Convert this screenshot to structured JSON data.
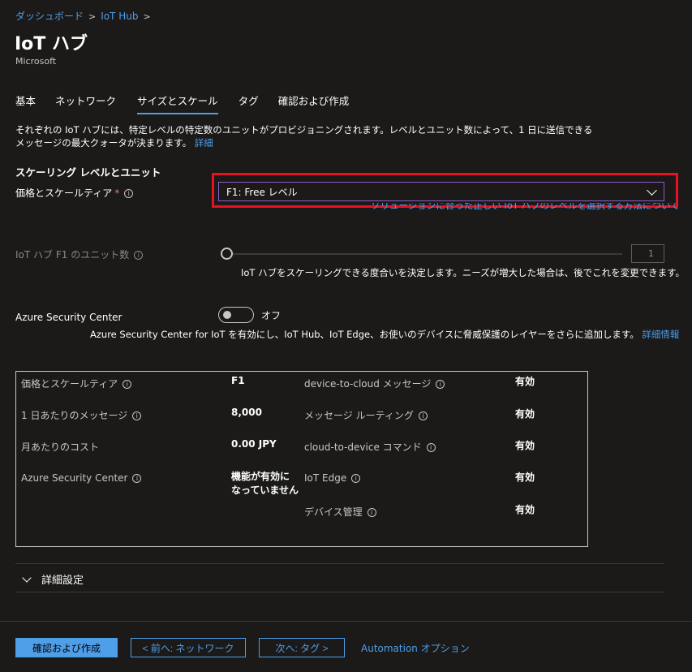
{
  "breadcrumb": {
    "items": [
      "ダッシュボード",
      "IoT Hub"
    ]
  },
  "header": {
    "title": "IoT ハブ",
    "subtitle": "Microsoft"
  },
  "tabs": [
    {
      "label": "基本"
    },
    {
      "label": "ネットワーク"
    },
    {
      "label": "サイズとスケール"
    },
    {
      "label": "タグ"
    },
    {
      "label": "確認および作成"
    }
  ],
  "intro": {
    "text": "それぞれの IoT ハブには、特定レベルの特定数のユニットがプロビジョニングされます。レベルとユニット数によって、1 日に送信できるメッセージの最大クォータが決まります。",
    "link": "詳細"
  },
  "scaling": {
    "heading": "スケーリング レベルとユニット",
    "tier_label": "価格とスケールティア",
    "required_mark": "*",
    "tier_value": "F1: Free レベル",
    "tier_help_link": "ソリューションに合った正しい IoT ハブのレベルを選択する方法について",
    "units_label": "IoT ハブ F1 のユニット数",
    "units_value": "1",
    "units_help": "IoT ハブをスケーリングできる度合いを決定します。ニーズが増大した場合は、後でこれを変更できます。"
  },
  "security": {
    "label": "Azure Security Center",
    "toggle_state": "オフ",
    "help": "Azure Security Center for IoT を有効にし、IoT Hub、IoT Edge、お使いのデバイスに脅威保護のレイヤーをさらに追加します。",
    "help_link": "詳細情報"
  },
  "summary": {
    "left": [
      {
        "label": "価格とスケールティア",
        "value": "F1"
      },
      {
        "label": "1 日あたりのメッセージ",
        "value": "8,000"
      },
      {
        "label": "月あたりのコスト",
        "value": "0.00 JPY"
      },
      {
        "label": "Azure Security Center",
        "value": "機能が有効に",
        "value2": "なっていません"
      }
    ],
    "right": [
      {
        "label": "device-to-cloud メッセージ",
        "value": "有効"
      },
      {
        "label": "メッセージ ルーティング",
        "value": "有効"
      },
      {
        "label": "cloud-to-device コマンド",
        "value": "有効"
      },
      {
        "label": "IoT Edge",
        "value": "有効"
      },
      {
        "label": "デバイス管理",
        "value": "有効"
      }
    ]
  },
  "advanced": {
    "label": "詳細設定"
  },
  "footer": {
    "review_create": "確認および作成",
    "prev": "< 前へ: ネットワーク",
    "next": "次へ: タグ >",
    "automation": "Automation オプション"
  },
  "colors": {
    "accent": "#4f9ee8",
    "highlight_box": "#e81123",
    "background": "#1b1a19"
  }
}
